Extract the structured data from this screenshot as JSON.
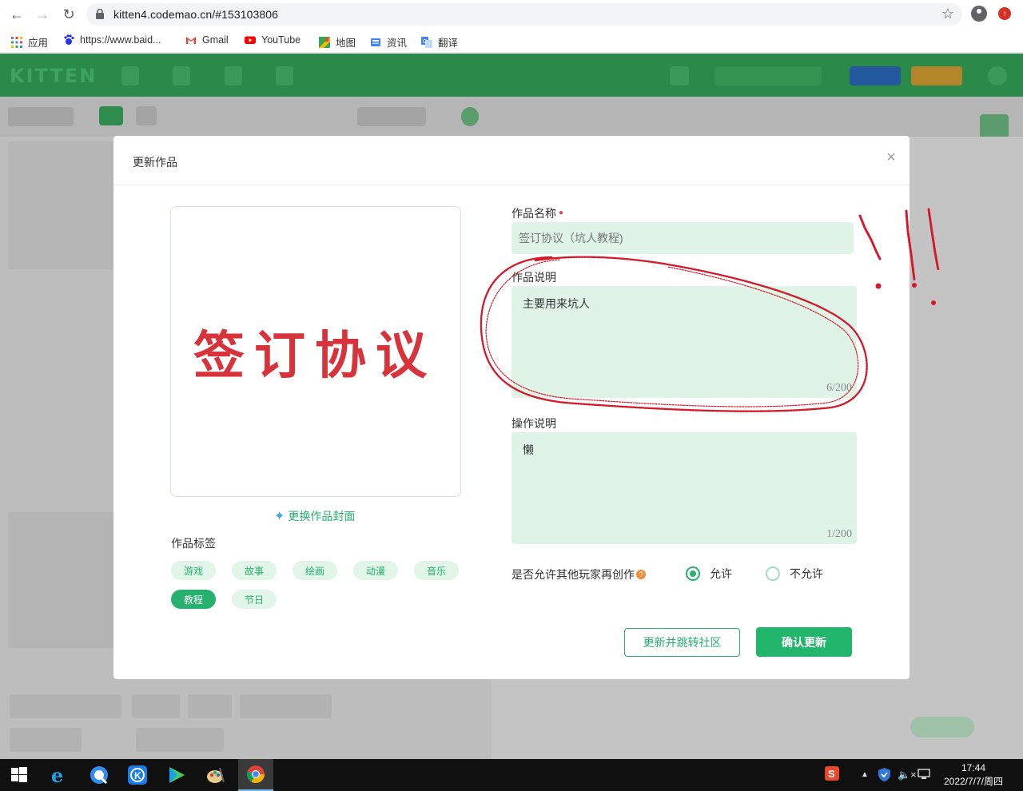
{
  "browser": {
    "url": "kitten4.codemao.cn/#153103806",
    "bookmarks": [
      {
        "label": "应用",
        "icon": "apps-grid-icon"
      },
      {
        "label": "https://www.baid...",
        "icon": "baidu-icon"
      },
      {
        "label": "Gmail",
        "icon": "gmail-icon"
      },
      {
        "label": "YouTube",
        "icon": "youtube-icon"
      },
      {
        "label": "地图",
        "icon": "maps-icon"
      },
      {
        "label": "资讯",
        "icon": "news-icon"
      },
      {
        "label": "翻译",
        "icon": "translate-icon"
      }
    ]
  },
  "app": {
    "logo": "KITTEN"
  },
  "modal": {
    "title": "更新作品",
    "cover": {
      "image_text": "签订协议",
      "change_label": "更换作品封面"
    },
    "tags": {
      "label": "作品标签",
      "items": [
        {
          "label": "游戏",
          "active": false
        },
        {
          "label": "故事",
          "active": false
        },
        {
          "label": "绘画",
          "active": false
        },
        {
          "label": "动漫",
          "active": false
        },
        {
          "label": "音乐",
          "active": false
        },
        {
          "label": "教程",
          "active": true
        },
        {
          "label": "节日",
          "active": false
        }
      ]
    },
    "name": {
      "label": "作品名称",
      "placeholder": "签订协议（坑人教程)"
    },
    "description": {
      "label": "作品说明",
      "value": "主要用来坑人",
      "counter": "6/200"
    },
    "instructions": {
      "label": "操作说明",
      "value": "懒",
      "counter": "1/200"
    },
    "remix": {
      "label": "是否允许其他玩家再创作",
      "help": "?",
      "options": [
        {
          "label": "允许",
          "selected": true
        },
        {
          "label": "不允许",
          "selected": false
        }
      ]
    },
    "buttons": {
      "update_jump": "更新并跳转社区",
      "confirm": "确认更新"
    }
  },
  "taskbar": {
    "time": "17:44",
    "date": "2022/7/7/周四"
  },
  "colors": {
    "accent": "#27b06e",
    "field_bg": "#dff4e7",
    "annotation_red": "#d41a2a"
  }
}
